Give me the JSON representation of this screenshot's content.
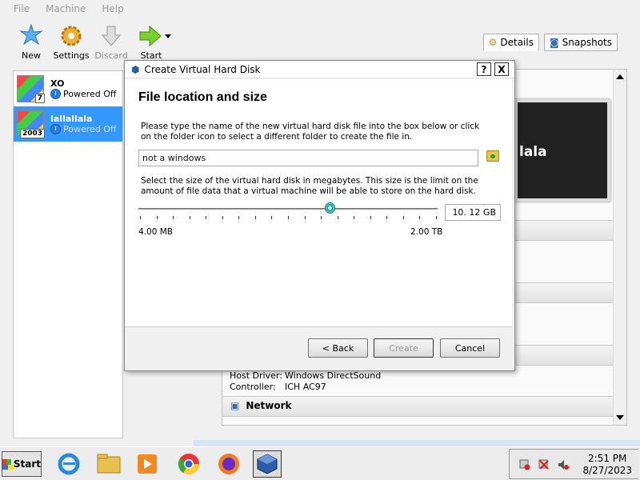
{
  "menubar": {
    "file": "File",
    "machine": "Machine",
    "help": "Help"
  },
  "toolbar": {
    "new": "New",
    "settings": "Settings",
    "discard": "Discard",
    "start": "Start"
  },
  "vm_list": [
    {
      "name": "XO",
      "state": "Powered Off",
      "os_badge": "7"
    },
    {
      "name": "lallallala",
      "state": "Powered Off",
      "os_badge": "2003"
    }
  ],
  "tabs": {
    "details": "Details",
    "snapshots": "Snapshots"
  },
  "details": {
    "preview_name": "lala",
    "audio": [
      {
        "key": "Host Driver:",
        "value": "Windows DirectSound"
      },
      {
        "key": "Controller:",
        "value": "ICH AC97"
      }
    ],
    "network_title": "Network"
  },
  "dialog": {
    "title": "Create Virtual Hard Disk",
    "help_btn": "?",
    "close_btn": "X",
    "heading": "File location and size",
    "location_text": "Please type the name of the new virtual hard disk file into the box below or click on the folder icon to select a different folder to create the file in.",
    "file_name": "not a windows",
    "size_text": "Select the size of the virtual hard disk in megabytes. This size is the limit on the amount of file data that a virtual machine will be able to store on the hard disk.",
    "size_value": "10. 12 GB",
    "min_label": "4.00 MB",
    "max_label": "2.00 TB",
    "slider_position": 0.62,
    "back": "< Back",
    "create": "Create",
    "cancel": "Cancel"
  },
  "taskbar": {
    "start": "Start",
    "time": "2:51 PM",
    "date": "8/27/2023"
  },
  "colors": {
    "selection": "#3399ff",
    "accent": "#2a7fd4"
  }
}
